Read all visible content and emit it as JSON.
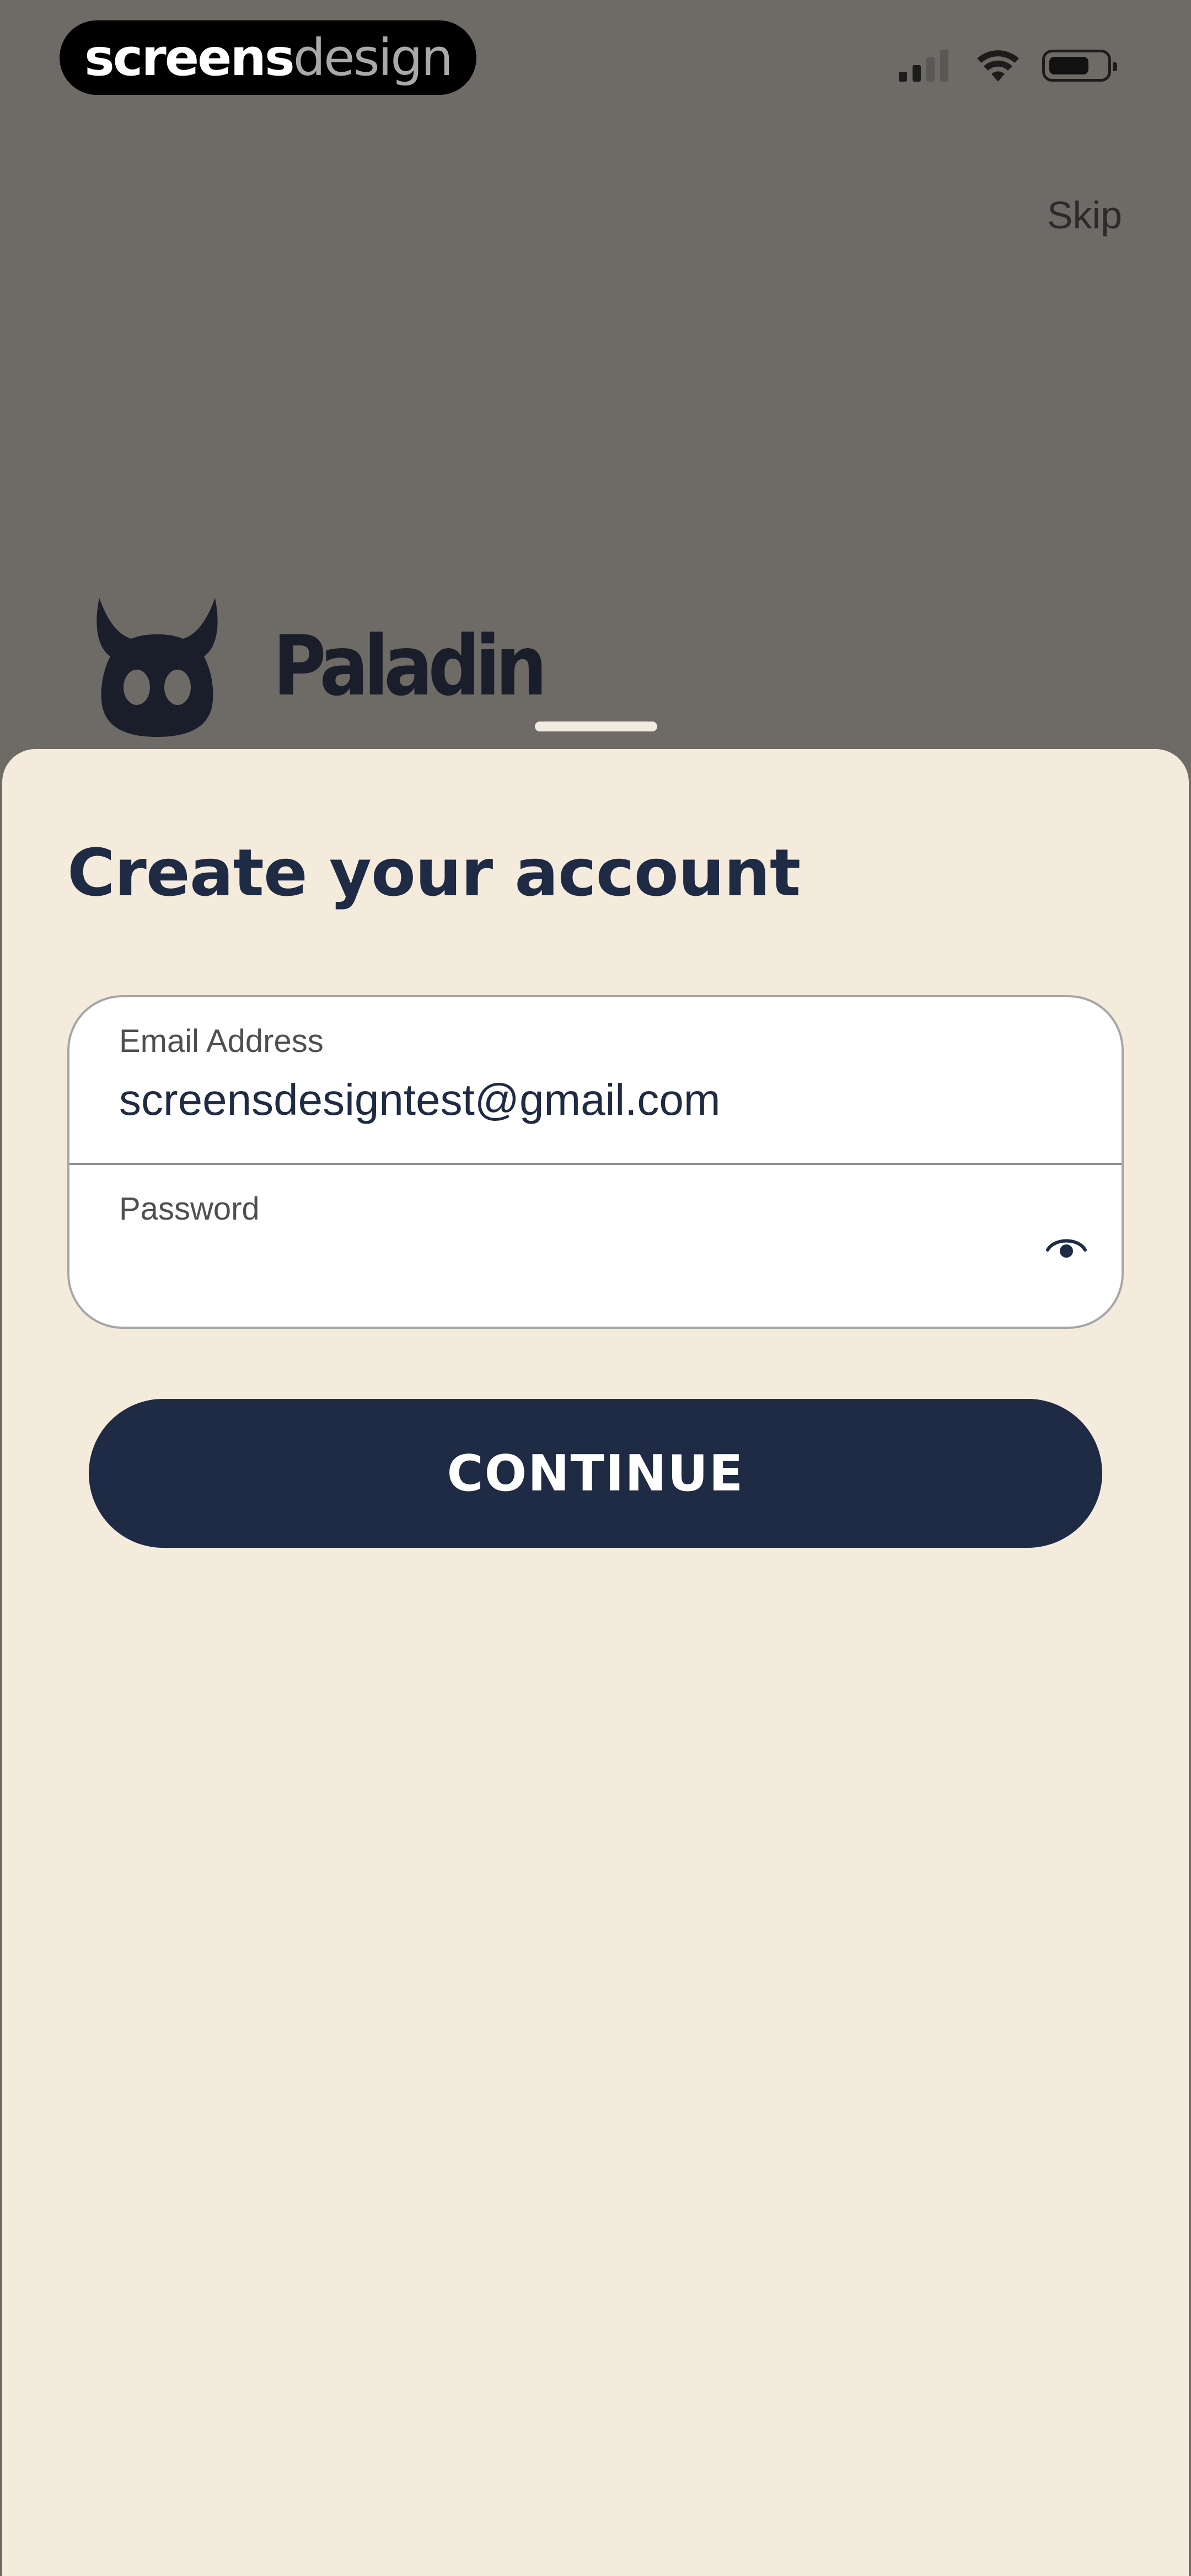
{
  "brand": {
    "part1": "screens",
    "part2": "design"
  },
  "status_bar": {
    "signal_icon": "cellular-signal-icon",
    "wifi_icon": "wifi-icon",
    "battery_icon": "battery-icon"
  },
  "header": {
    "skip_label": "Skip"
  },
  "logo": {
    "icon": "horned-mascot-icon",
    "name": "Paladin"
  },
  "sheet": {
    "title": "Create your account",
    "email": {
      "label": "Email Address",
      "value": "screensdesigntest@gmail.com"
    },
    "password": {
      "label": "Password",
      "value": "",
      "toggle_icon": "eye-icon"
    },
    "continue_label": "CONTINUE"
  },
  "colors": {
    "backdrop": "#6e6b67",
    "sheet": "#f4ebdd",
    "primary": "#1f2a44"
  }
}
